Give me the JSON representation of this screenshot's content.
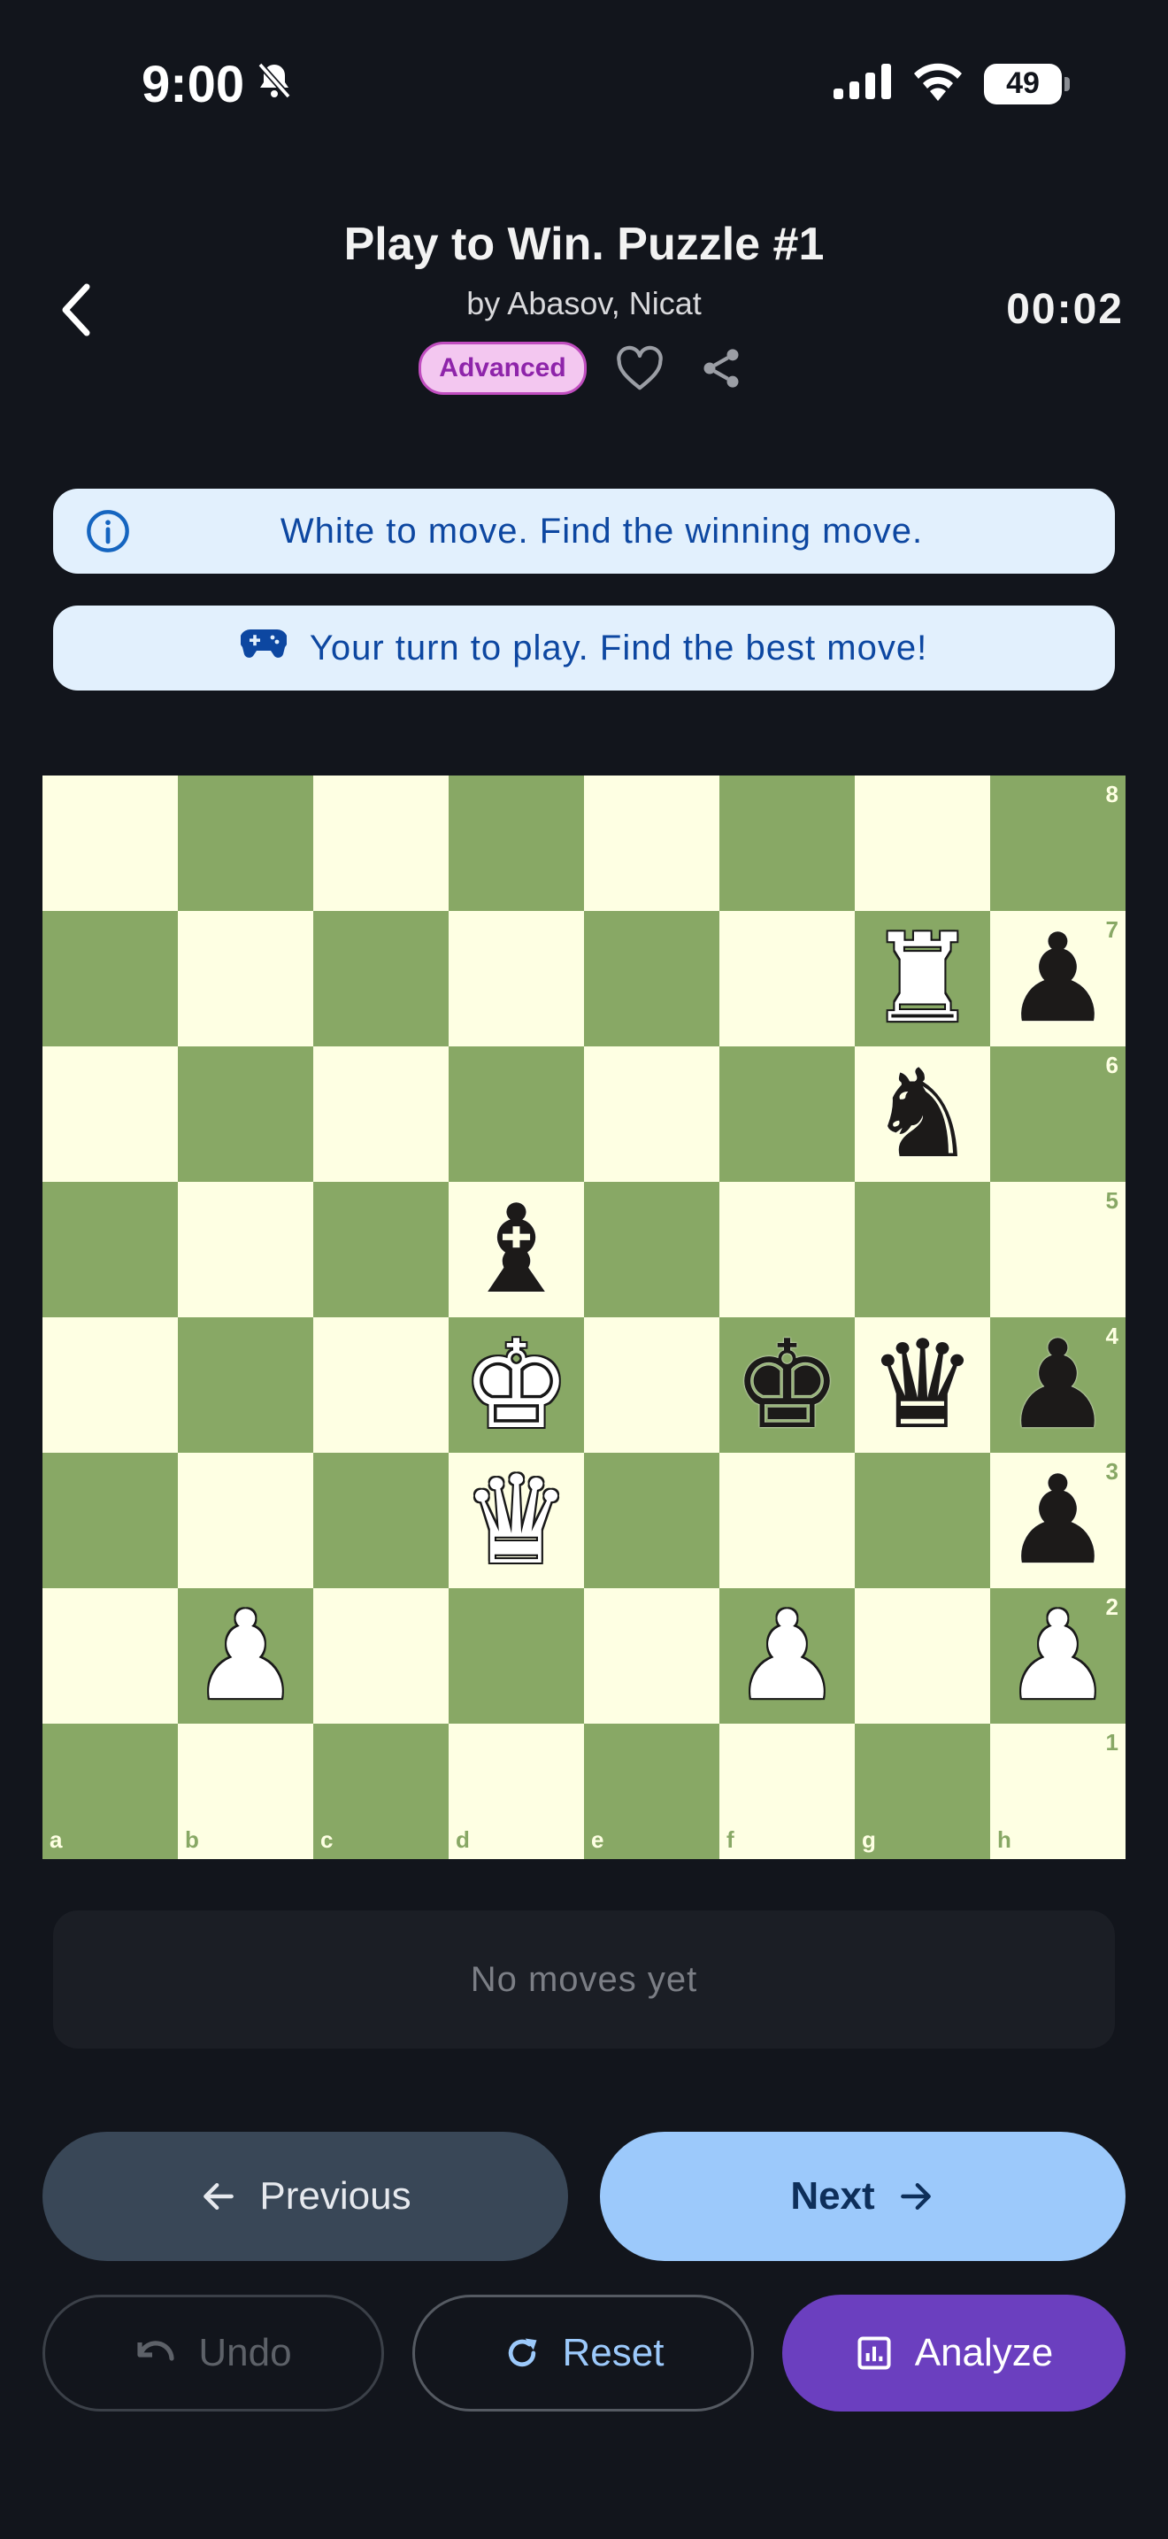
{
  "status_bar": {
    "time": "9:00",
    "battery": "49"
  },
  "header": {
    "title": "Play to Win. Puzzle #1",
    "author": "by Abasov, Nicat",
    "timer": "00:02",
    "difficulty_badge": "Advanced"
  },
  "banners": {
    "instruction": "White to move. Find the winning move.",
    "prompt": "Your turn to play. Find the best move!"
  },
  "board": {
    "light_color": "#feffe3",
    "dark_color": "#88a865",
    "rank_labels": [
      "8",
      "7",
      "6",
      "5",
      "4",
      "3",
      "2",
      "1"
    ],
    "file_labels": [
      "a",
      "b",
      "c",
      "d",
      "e",
      "f",
      "g",
      "h"
    ],
    "pieces": [
      {
        "square": "g7",
        "piece": "white-rook"
      },
      {
        "square": "h7",
        "piece": "black-pawn"
      },
      {
        "square": "g6",
        "piece": "black-knight"
      },
      {
        "square": "d5",
        "piece": "black-bishop"
      },
      {
        "square": "d4",
        "piece": "white-king"
      },
      {
        "square": "f4",
        "piece": "black-king"
      },
      {
        "square": "g4",
        "piece": "black-queen"
      },
      {
        "square": "h4",
        "piece": "black-pawn"
      },
      {
        "square": "d3",
        "piece": "white-queen"
      },
      {
        "square": "h3",
        "piece": "black-pawn"
      },
      {
        "square": "b2",
        "piece": "white-pawn"
      },
      {
        "square": "f2",
        "piece": "white-pawn"
      },
      {
        "square": "h2",
        "piece": "white-pawn"
      }
    ]
  },
  "moves_panel": {
    "empty_text": "No moves yet"
  },
  "buttons": {
    "previous": "Previous",
    "next": "Next",
    "undo": "Undo",
    "reset": "Reset",
    "analyze": "Analyze"
  },
  "colors": {
    "background": "#12151c",
    "banner_bg": "#e2f0fd",
    "banner_text": "#0d47a1",
    "next_button": "#9cc9fb",
    "previous_button": "#394757",
    "analyze_button": "#6b3fbf",
    "badge_bg": "#f3c7f0",
    "badge_text": "#8e24aa"
  }
}
